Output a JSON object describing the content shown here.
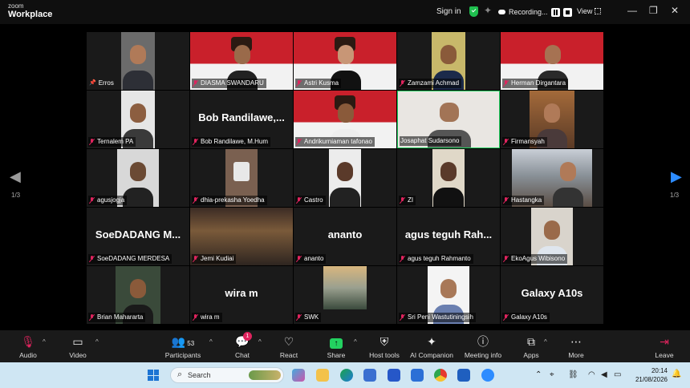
{
  "titlebar": {
    "brand_top": "zoom",
    "brand_bottom": "Workplace",
    "sign_in": "Sign in",
    "recording": "Recording...",
    "view": "View"
  },
  "nav": {
    "left_page": "1/3",
    "right_page": "1/3"
  },
  "participants": [
    {
      "name": "Erros",
      "kind": "photo",
      "pinned": true
    },
    {
      "name": "DIASMA SWANDARU",
      "kind": "photo",
      "bg": "flag"
    },
    {
      "name": "Astri Kusma",
      "kind": "photo",
      "bg": "flag"
    },
    {
      "name": "Zamzami Achmad",
      "kind": "photo"
    },
    {
      "name": "Herman Dirgantara",
      "kind": "photo",
      "bg": "flag"
    },
    {
      "name": "Ternalem PA",
      "kind": "photo"
    },
    {
      "name": "Bob Randilawe, M.Hum",
      "kind": "text",
      "display": "Bob  Randilawe,..."
    },
    {
      "name": "Andrikurniaman tafonao",
      "kind": "photo",
      "bg": "flag"
    },
    {
      "name": "Josaphat Sudarsono",
      "kind": "photo",
      "bg": "light",
      "speaking": true
    },
    {
      "name": "Firmansyah",
      "kind": "photo"
    },
    {
      "name": "agusjogja",
      "kind": "photo"
    },
    {
      "name": "dhia-prekasha Yoedha",
      "kind": "photo"
    },
    {
      "name": "Castro",
      "kind": "photo"
    },
    {
      "name": "ZI",
      "kind": "photo"
    },
    {
      "name": "Hastangka",
      "kind": "photo",
      "bg": "street"
    },
    {
      "name": "SoeDADANG MERDESA",
      "kind": "text",
      "display": "SoeDADANG  M..."
    },
    {
      "name": "Jemi Kudiai",
      "kind": "photo",
      "bg": "night"
    },
    {
      "name": "ananto",
      "kind": "text",
      "display": "ananto"
    },
    {
      "name": "agus teguh Rahmanto",
      "kind": "text",
      "display": "agus  teguh  Rah..."
    },
    {
      "name": "EkoAgus Wibisono",
      "kind": "photo"
    },
    {
      "name": "Brian Mahararta",
      "kind": "photo"
    },
    {
      "name": "wira m",
      "kind": "text",
      "display": "wira m"
    },
    {
      "name": "SWK",
      "kind": "photo",
      "bg": "sky"
    },
    {
      "name": "Sri Peni Wastutiningsih",
      "kind": "photo",
      "bg": "light"
    },
    {
      "name": "Galaxy A10s",
      "kind": "text",
      "display": "Galaxy A10s"
    }
  ],
  "toolbar": {
    "audio": "Audio",
    "video": "Video",
    "participants": "Participants",
    "participant_count": "53",
    "chat": "Chat",
    "chat_badge": "1",
    "react": "React",
    "share": "Share",
    "host_tools": "Host tools",
    "ai_companion": "AI Companion",
    "meeting_info": "Meeting info",
    "apps": "Apps",
    "more": "More",
    "leave": "Leave"
  },
  "taskbar": {
    "search_placeholder": "Search",
    "time": "20:14",
    "date": "21/08/2026"
  },
  "colors": {
    "speaker_border": "#23d160",
    "muted": "#e0245e",
    "accent": "#2d8cff",
    "share": "#23d160"
  }
}
